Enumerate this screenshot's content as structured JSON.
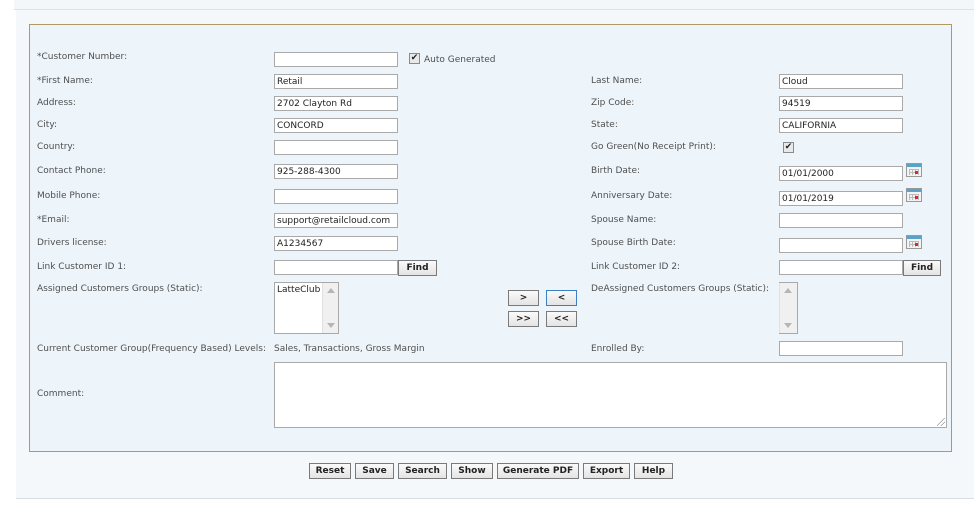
{
  "form": {
    "customer_number": {
      "label": "*Customer Number:",
      "value": ""
    },
    "auto_generated": {
      "label": "Auto Generated",
      "checked": "✔"
    },
    "first_name": {
      "label": "*First Name:",
      "value": "Retail"
    },
    "last_name": {
      "label": "Last Name:",
      "value": "Cloud"
    },
    "address": {
      "label": "Address:",
      "value": "2702 Clayton Rd"
    },
    "zip_code": {
      "label": "Zip Code:",
      "value": "94519"
    },
    "city": {
      "label": "City:",
      "value": "CONCORD"
    },
    "state": {
      "label": "State:",
      "value": "CALIFORNIA"
    },
    "country": {
      "label": "Country:",
      "value": ""
    },
    "go_green": {
      "label": "Go Green(No Receipt Print):",
      "checked": "✔"
    },
    "contact_phone": {
      "label": "Contact Phone:",
      "value": "925-288-4300"
    },
    "birth_date": {
      "label": "Birth Date:",
      "value": "01/01/2000"
    },
    "mobile_phone": {
      "label": "Mobile Phone:",
      "value": ""
    },
    "anniversary_date": {
      "label": "Anniversary Date:",
      "value": "01/01/2019"
    },
    "email": {
      "label": "*Email:",
      "value": "support@retailcloud.com"
    },
    "spouse_name": {
      "label": "Spouse Name:",
      "value": ""
    },
    "drivers_license": {
      "label": "Drivers license:",
      "value": "A1234567"
    },
    "spouse_birth_date": {
      "label": "Spouse Birth Date:",
      "value": ""
    },
    "link_customer_1": {
      "label": "Link Customer ID 1:",
      "value": "",
      "find": "Find"
    },
    "link_customer_2": {
      "label": "Link Customer ID 2:",
      "value": "",
      "find": "Find"
    },
    "assigned_groups": {
      "label": "Assigned Customers Groups (Static):",
      "options": [
        "LatteClub"
      ]
    },
    "deassigned_groups": {
      "label": "DeAssigned Customers Groups (Static):",
      "options": []
    },
    "move": {
      "assign_one": ">",
      "unassign_one": "<",
      "assign_all": ">>",
      "unassign_all": "<<"
    },
    "current_group": {
      "label": "Current Customer Group(Frequency Based) Levels:",
      "value": "Sales, Transactions, Gross Margin"
    },
    "enrolled_by": {
      "label": "Enrolled By:",
      "value": ""
    },
    "comment": {
      "label": "Comment:",
      "value": ""
    }
  },
  "actions": {
    "reset": "Reset",
    "save": "Save",
    "search": "Search",
    "show": "Show",
    "generate_pdf": "Generate PDF",
    "export": "Export",
    "help": "Help"
  }
}
